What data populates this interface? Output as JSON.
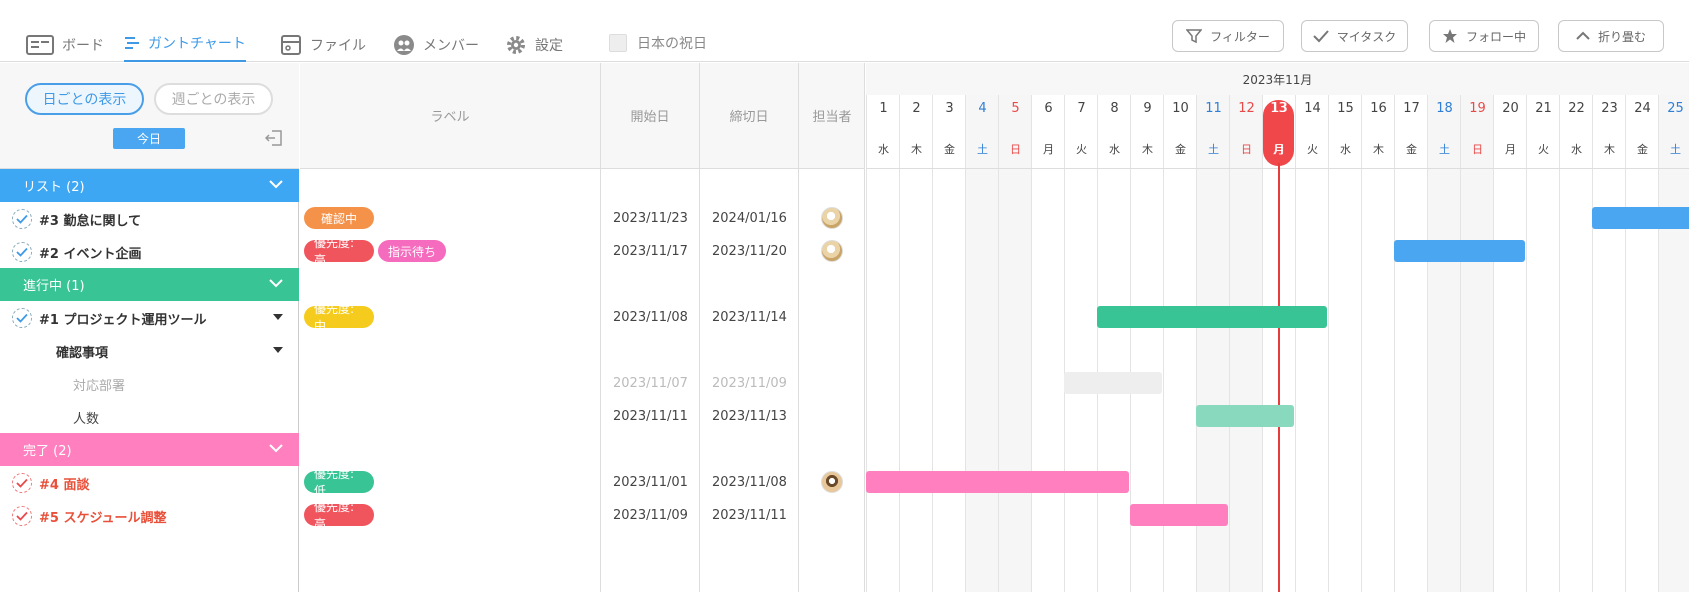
{
  "tabs": [
    {
      "label": "ボード",
      "icon": "board-icon"
    },
    {
      "label": "ガントチャート",
      "icon": "gantt-icon"
    },
    {
      "label": "ファイル",
      "icon": "file-icon"
    },
    {
      "label": "メンバー",
      "icon": "members-icon"
    },
    {
      "label": "設定",
      "icon": "gear-icon"
    }
  ],
  "holiday_checkbox": {
    "label": "日本の祝日",
    "checked": false
  },
  "toolbar": {
    "filter": "フィルター",
    "my_tasks": "マイタスク",
    "following": "フォロー中",
    "collapse": "折り畳む"
  },
  "view": {
    "day": "日ごとの表示",
    "week": "週ごとの表示",
    "today": "今日"
  },
  "columns": {
    "label": "ラベル",
    "start": "開始日",
    "due": "締切日",
    "assignee": "担当者"
  },
  "groups": [
    {
      "label": "リスト (2)",
      "color": "#3ea7f3"
    },
    {
      "label": "進行中 (1)",
      "color": "#39c495"
    },
    {
      "label": "完了 (2)",
      "color": "#ff7fbf"
    }
  ],
  "tasks": [
    {
      "title": "#3 勤怠に関して",
      "labels": [
        {
          "text": "確認中",
          "color": "#f5924a"
        }
      ],
      "start": "2023/11/23",
      "due": "2024/01/16"
    },
    {
      "title": "#2 イベント企画",
      "labels": [
        {
          "text": "優先度:高",
          "color": "#f0555e"
        },
        {
          "text": "指示待ち",
          "color": "#f56bbd"
        }
      ],
      "start": "2023/11/17",
      "due": "2023/11/20"
    },
    {
      "title": "#1 プロジェクト運用ツール",
      "labels": [
        {
          "text": "優先度:中",
          "color": "#f5cc1e"
        }
      ],
      "start": "2023/11/08",
      "due": "2023/11/14"
    },
    {
      "title": "確認事項"
    },
    {
      "title": "対応部署",
      "start": "2023/11/07",
      "due": "2023/11/09"
    },
    {
      "title": "人数",
      "start": "2023/11/11",
      "due": "2023/11/13"
    },
    {
      "title": "#4 面談",
      "labels": [
        {
          "text": "優先度:低",
          "color": "#39c495"
        }
      ],
      "start": "2023/11/01",
      "due": "2023/11/08"
    },
    {
      "title": "#5 スケジュール調整",
      "labels": [
        {
          "text": "優先度:高",
          "color": "#f0555e"
        }
      ],
      "start": "2023/11/09",
      "due": "2023/11/11"
    }
  ],
  "gantt": {
    "month": "2023年11月",
    "days": [
      "1",
      "2",
      "3",
      "4",
      "5",
      "6",
      "7",
      "8",
      "9",
      "10",
      "11",
      "12",
      "13",
      "14",
      "15",
      "16",
      "17",
      "18",
      "19",
      "20",
      "21",
      "22",
      "23",
      "24",
      "25"
    ],
    "dow": [
      "水",
      "木",
      "金",
      "土",
      "日",
      "月",
      "火",
      "水",
      "木",
      "金",
      "土",
      "日",
      "月",
      "火",
      "水",
      "木",
      "金",
      "土",
      "日",
      "月",
      "火",
      "水",
      "木",
      "金",
      "土"
    ],
    "today": 13,
    "bars": [
      {
        "start": 23,
        "end": 30,
        "color": "#4aa6f0"
      },
      {
        "start": 17,
        "end": 20,
        "color": "#4aa6f0"
      },
      {
        "start": 8,
        "end": 14,
        "color": "#39c495"
      },
      {
        "start": 7,
        "end": 9,
        "color": "#eeeeee"
      },
      {
        "start": 11,
        "end": 13,
        "color": "#88d9bd"
      },
      {
        "start": 1,
        "end": 8,
        "color": "#ff7fbf"
      },
      {
        "start": 9,
        "end": 11,
        "color": "#ff7fbf"
      }
    ]
  }
}
